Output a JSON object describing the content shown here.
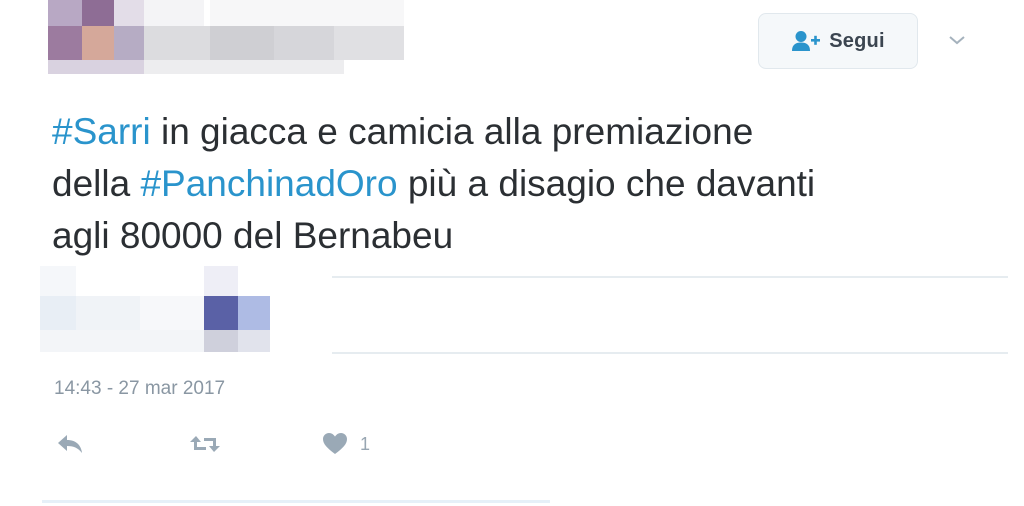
{
  "follow_button": {
    "label": "Segui",
    "icon": "add-user-icon"
  },
  "menu_caret_icon": "chevron-down-icon",
  "tweet": {
    "lines": [
      [
        {
          "text": "#Sarri",
          "hashtag": true
        },
        {
          "text": " in giacca e camicia alla premiazione",
          "hashtag": false
        }
      ],
      [
        {
          "text": "della ",
          "hashtag": false
        },
        {
          "text": "#PanchinadOro",
          "hashtag": true
        },
        {
          "text": " più a disagio che davanti",
          "hashtag": false
        }
      ],
      [
        {
          "text": "agli 80000 del Bernabeu",
          "hashtag": false
        }
      ]
    ]
  },
  "timestamp": "14:43 - 27 mar 2017",
  "actions": {
    "reply_icon": "reply-icon",
    "retweet_icon": "retweet-icon",
    "like_icon": "heart-icon",
    "like_count": "1"
  },
  "colors": {
    "hashtag": "#2a94cc",
    "text": "#2b2f33",
    "muted": "#8a97a3"
  }
}
